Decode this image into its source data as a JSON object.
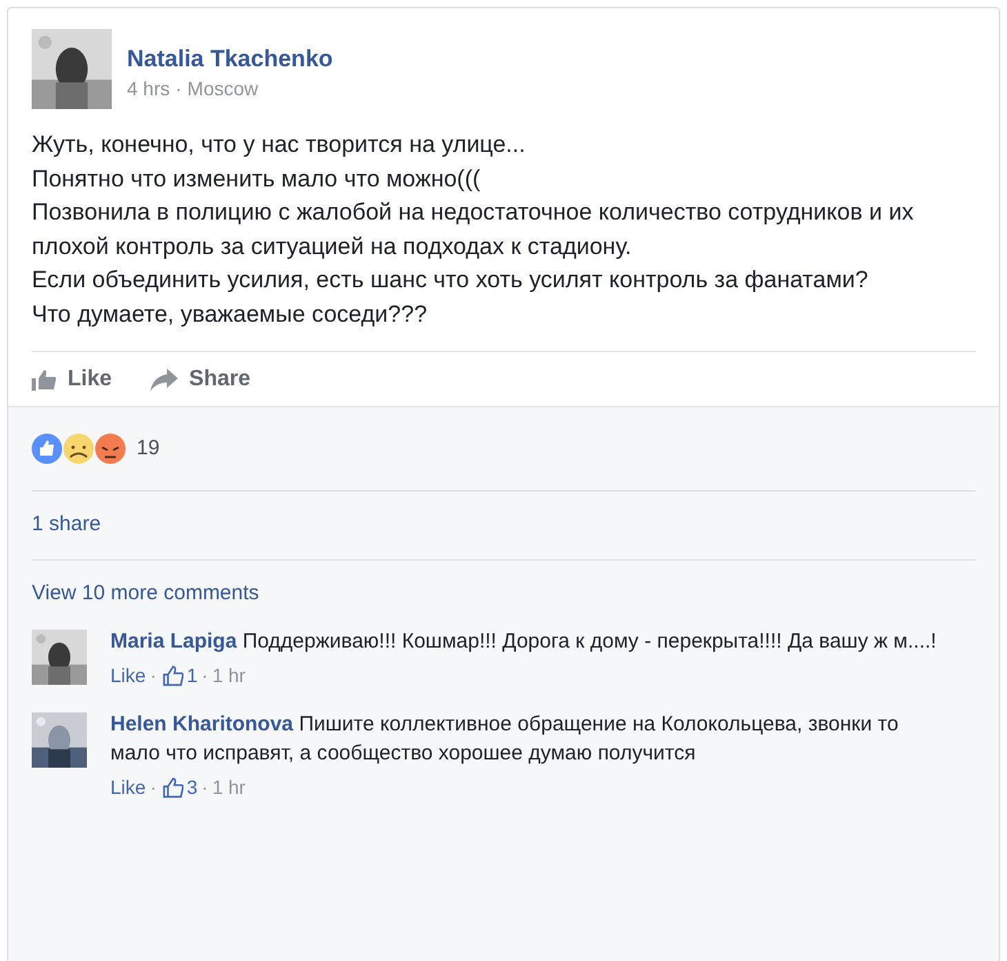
{
  "post": {
    "author": "Natalia Tkachenko",
    "time": "4 hrs",
    "separator": "·",
    "location": "Moscow",
    "paragraphs": [
      "Жуть, конечно, что у нас творится на улице...",
      "Понятно что изменить мало что можно(((",
      "Позвонила в полицию с жалобой на недостаточное количество сотрудников и их плохой контроль за ситуацией на подходах к стадиону.",
      "Если объединить усилия, есть шанс что хоть усилят контроль за фанатами?",
      "Что думаете, уважаемые соседи???"
    ]
  },
  "actions": [
    {
      "kind": "like",
      "label": "Like"
    },
    {
      "kind": "share",
      "label": "Share"
    }
  ],
  "reactions": {
    "count": "19"
  },
  "shares": "1 share",
  "view_more": "View 10 more comments",
  "comments": [
    {
      "author": "Maria Lapiga",
      "text": "Поддерживаю!!! Кошмар!!! Дорога к дому - перекрыта!!!! Да вашу ж м....!",
      "like": "Like",
      "separator": "·",
      "likes": "1",
      "time": "1 hr"
    },
    {
      "author": "Helen Kharitonova",
      "text": "Пишите коллективное обращение на Колокольцева, звонки то мало что исправят, а сообщество хорошее думаю получится",
      "like": "Like",
      "separator": "·",
      "likes": "3",
      "time": "1 hr"
    }
  ]
}
